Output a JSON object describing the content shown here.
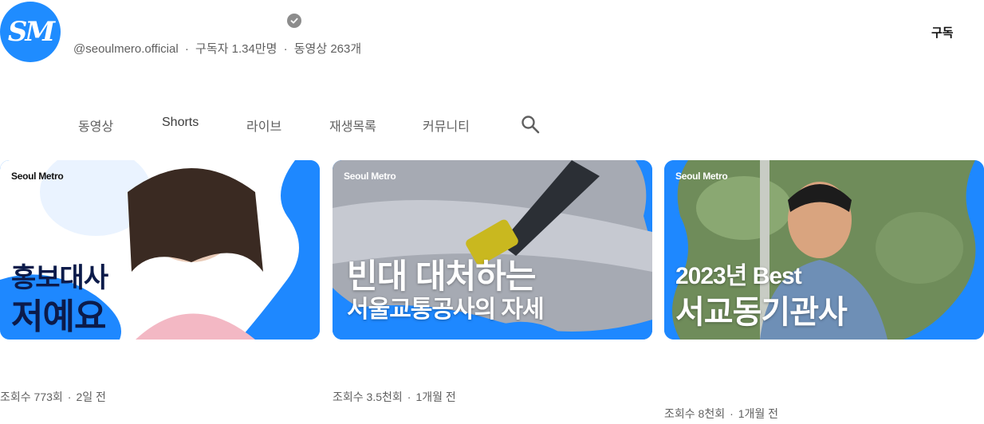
{
  "channel": {
    "avatar_text": "SM",
    "handle": "@seoulmero.official",
    "subscribers": "구독자 1.34만명",
    "videos": "동영상 263개",
    "separator": "·",
    "subscribe_label": "구독"
  },
  "tabs": [
    {
      "label": "동영상"
    },
    {
      "label": "Shorts"
    },
    {
      "label": "라이브"
    },
    {
      "label": "재생목록"
    },
    {
      "label": "커뮤니티"
    }
  ],
  "videos": [
    {
      "brand": "Seoul Metro",
      "title_line1": "홍보대사",
      "title_line2": "저예요",
      "views": "조회수 773회",
      "age": "2일 전"
    },
    {
      "brand": "Seoul Metro",
      "title_line1": "빈대 대처하는",
      "title_line2": "서울교통공사의 자세",
      "views": "조회수 3.5천회",
      "age": "1개월 전"
    },
    {
      "brand": "Seoul Metro",
      "title_line1": "2023년 Best",
      "title_line2": "서교동기관사",
      "views": "조회수 8천회",
      "age": "1개월 전"
    }
  ],
  "colors": {
    "brand_blue": "#1f8cff",
    "thumb_blue": "#1e88ff",
    "meta_gray": "#606060",
    "verified_gray": "#8c8c8c"
  },
  "icons": [
    "verified-badge-icon",
    "search-icon"
  ]
}
